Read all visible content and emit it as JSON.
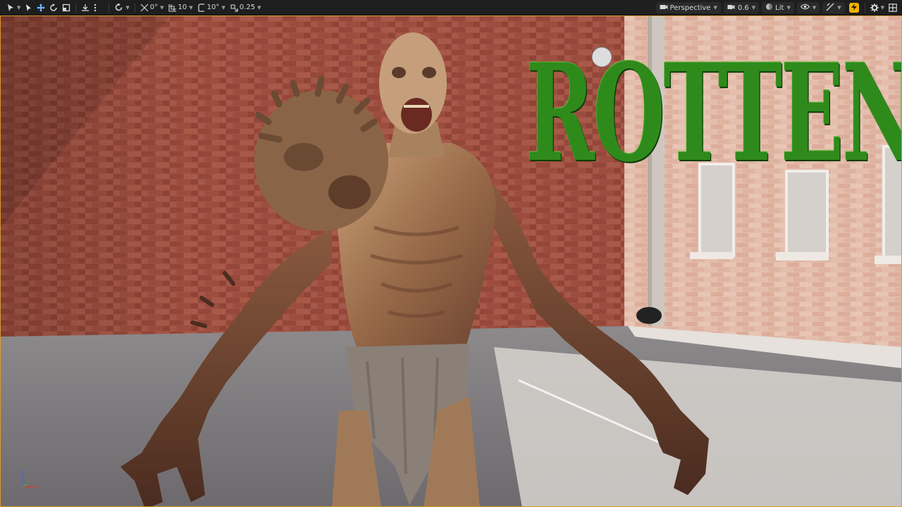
{
  "toolbar": {
    "translate_snap": "0°",
    "grid_snap": "10",
    "rotation_snap": "10°",
    "scale_snap": "0.25",
    "view_mode_label": "Perspective",
    "camera_speed": "0.6",
    "lit_label": "Lit"
  },
  "viewport": {
    "title_text": "ROTTEN",
    "gizmo": {
      "z": "z",
      "x": "x"
    }
  },
  "colors": {
    "toolbar_bg": "#1e1e1e",
    "viewport_border": "#d99a2b",
    "accent_yellow": "#f3b400",
    "title_green": "#2f8a1c",
    "brick": "#9b4a3f"
  },
  "icons": [
    "select-icon",
    "cursor-icon",
    "translate-icon",
    "rotate-icon",
    "scale-icon",
    "surface-snap-icon",
    "more-icon",
    "realtime-icon",
    "angle-snap-icon",
    "grid-icon",
    "rotate-snap-icon",
    "scale-snap-icon",
    "camera-icon",
    "speed-icon",
    "lit-icon",
    "show-icon",
    "performance-icon",
    "settings-icon",
    "layout-icon"
  ]
}
